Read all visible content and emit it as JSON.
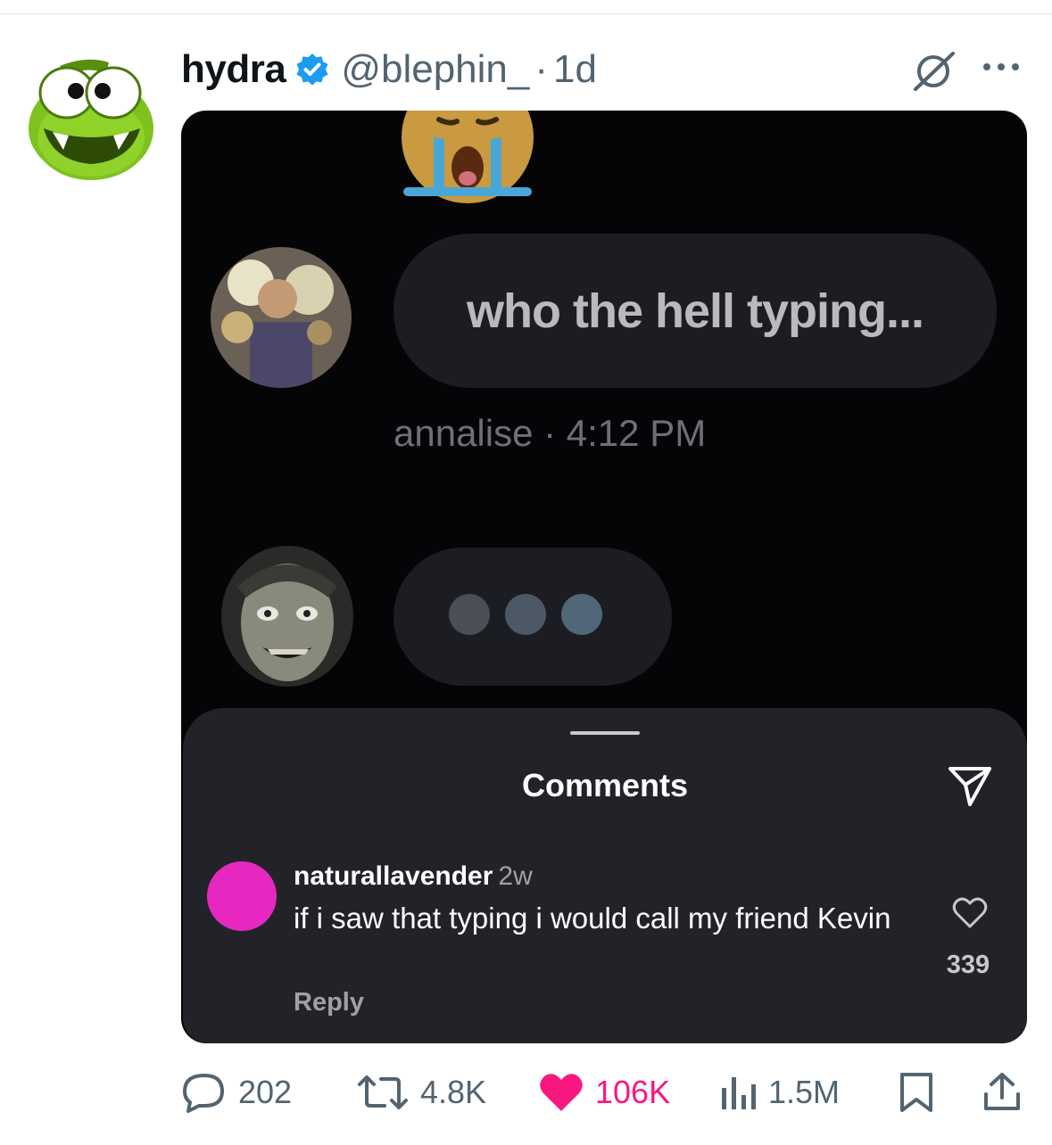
{
  "post": {
    "display_name": "hydra",
    "handle": "@blephin_",
    "separator": "·",
    "time_ago": "1d"
  },
  "media": {
    "message_text": "who the hell typing...",
    "message_meta": "annalise · 4:12 PM",
    "comments_sheet": {
      "title": "Comments",
      "comment": {
        "username": "naturallavender",
        "ago": "2w",
        "text": "if i saw that typing i would call my friend Kevin",
        "reply_label": "Reply",
        "like_count": "339"
      }
    }
  },
  "actions": {
    "replies": "202",
    "reposts": "4.8K",
    "likes": "106K",
    "views": "1.5M"
  },
  "colors": {
    "like_pink": "#f91880",
    "verified_blue": "#1d9bf0",
    "muted": "#536471"
  },
  "icons": [
    "verified-badge-icon",
    "grok-icon",
    "more-icon",
    "send-icon",
    "heart-outline-icon",
    "reply-icon",
    "repost-icon",
    "like-heart-icon",
    "views-icon",
    "bookmark-icon",
    "share-icon"
  ]
}
